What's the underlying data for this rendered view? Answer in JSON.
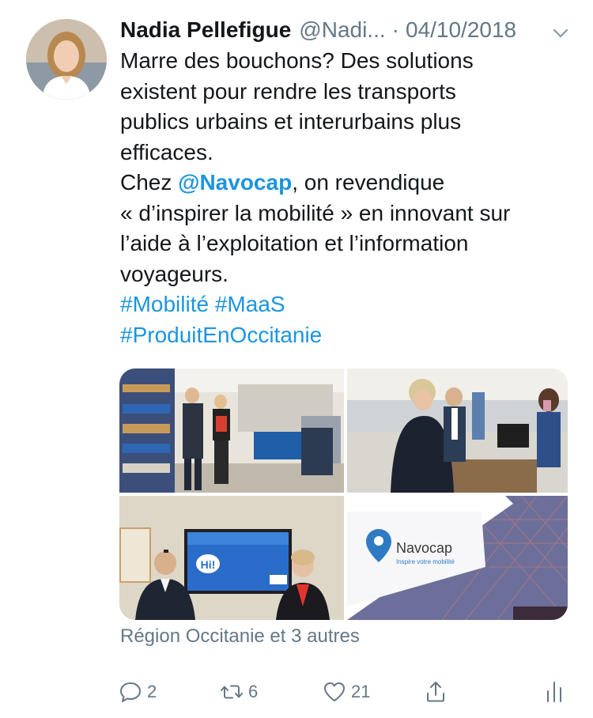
{
  "tweet": {
    "author_name": "Nadia Pellefigue",
    "handle": "@Nadi...",
    "separator": "·",
    "date": "04/10/2018",
    "text_lines": [
      "Marre des bouchons? Des solutions",
      "existent pour rendre les transports",
      "publics urbains et interurbains plus",
      "efficaces."
    ],
    "chez_prefix": "Chez ",
    "mention": "@Navocap",
    "chez_suffix": ", on revendique",
    "text_lines_2": [
      "« d’inspirer la mobilité » en innovant sur",
      "l’aide à l’exploitation et l’information",
      "voyageurs."
    ],
    "hashtags_line1": [
      "#Mobilité",
      "#MaaS"
    ],
    "hashtags_line2": [
      "#ProduitEnOccitanie"
    ],
    "location": "Région Occitanie et 3 autres"
  },
  "media": {
    "photo4": {
      "brand": "Navocap",
      "tagline": "Inspire votre mobilité"
    },
    "photo3": {
      "screen_greeting": "Hi!"
    }
  },
  "actions": {
    "reply_count": "2",
    "retweet_count": "6",
    "like_count": "21"
  },
  "icons": {
    "reply": "reply-icon",
    "retweet": "retweet-icon",
    "like": "heart-icon",
    "share": "share-icon",
    "analytics": "analytics-icon",
    "more": "chevron-down-icon"
  },
  "colors": {
    "link": "#1b95e0",
    "secondary_text": "#657786",
    "primary_text": "#14171a"
  }
}
